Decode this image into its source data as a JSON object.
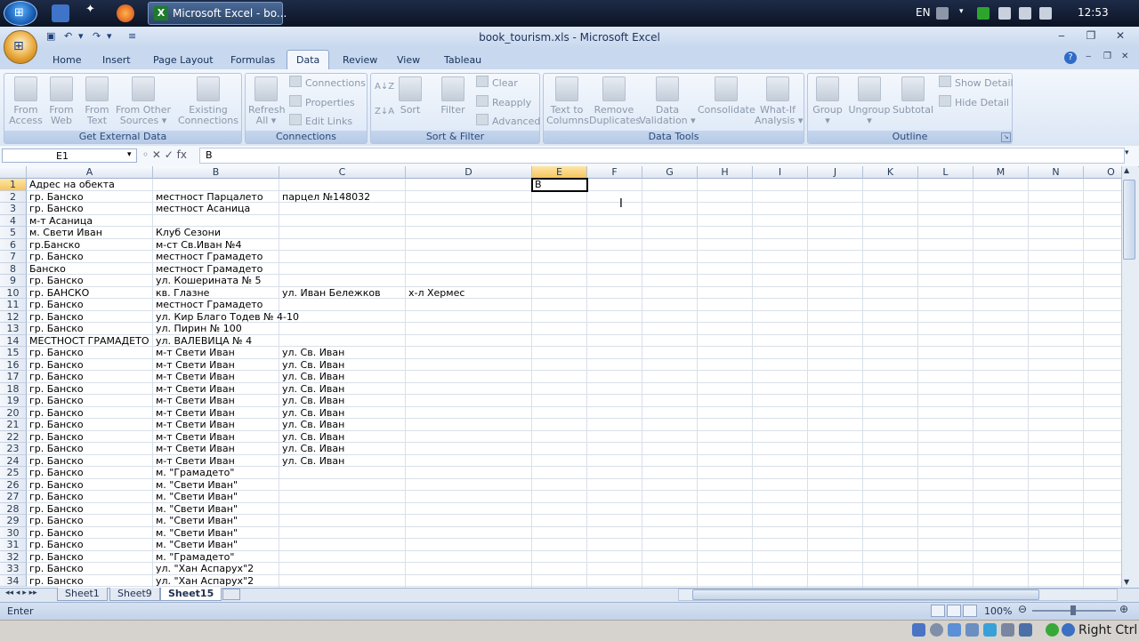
{
  "taskbar": {
    "excel_task_label": "Microsoft Excel - bo...",
    "language": "EN",
    "clock": "12:53",
    "start_glyph": "⊞",
    "excel_glyph": "X"
  },
  "window": {
    "title": "book_tourism.xls - Microsoft Excel",
    "qat": [
      "▣",
      "↶",
      "▾",
      "↷",
      "▾",
      "≡"
    ],
    "controls": [
      "‒",
      "❐",
      "✕"
    ],
    "ribbon_controls": [
      "?",
      "‒",
      "❐",
      "✕"
    ]
  },
  "ribbon_tabs": [
    {
      "label": "Home"
    },
    {
      "label": "Insert"
    },
    {
      "label": "Page Layout"
    },
    {
      "label": "Formulas"
    },
    {
      "label": "Data"
    },
    {
      "label": "Review"
    },
    {
      "label": "View"
    },
    {
      "label": "Tableau"
    }
  ],
  "active_tab": "Data",
  "ribbon": {
    "get_external": {
      "label": "Get External Data",
      "buttons": [
        "From\nAccess",
        "From\nWeb",
        "From\nText",
        "From Other\nSources ▾",
        "Existing\nConnections"
      ]
    },
    "connections": {
      "label": "Connections",
      "refresh": "Refresh\nAll ▾",
      "items": [
        "Connections",
        "Properties",
        "Edit Links"
      ]
    },
    "sort_filter": {
      "label": "Sort & Filter",
      "sort_az": "A↓Z",
      "sort_za": "Z↓A",
      "sort": "Sort",
      "filter": "Filter",
      "items": [
        "Clear",
        "Reapply",
        "Advanced"
      ]
    },
    "data_tools": {
      "label": "Data Tools",
      "buttons": [
        "Text to\nColumns",
        "Remove\nDuplicates",
        "Data\nValidation ▾",
        "Consolidate",
        "What-If\nAnalysis ▾"
      ]
    },
    "outline": {
      "label": "Outline",
      "buttons": [
        "Group\n▾",
        "Ungroup\n▾",
        "Subtotal"
      ],
      "items": [
        "Show Detail",
        "Hide Detail"
      ]
    }
  },
  "formula_bar": {
    "name_box": "E1",
    "buttons": "◦ ✕ ✓ fx",
    "content": "B"
  },
  "columns": [
    "A",
    "B",
    "C",
    "D",
    "E",
    "F",
    "G",
    "H",
    "I",
    "J",
    "K",
    "L",
    "M",
    "N",
    "O"
  ],
  "selected_column": "E",
  "selected_row": "1",
  "active_cell_value": "B",
  "rows": [
    {
      "n": "1",
      "a": "Адрес на обекта",
      "b": "",
      "c": "",
      "d": ""
    },
    {
      "n": "2",
      "a": "гр. Банско",
      "b": "местност Парцалето",
      "c": "парцел №148032",
      "d": ""
    },
    {
      "n": "3",
      "a": "гр. Банско",
      "b": "местност Асаница",
      "c": "",
      "d": ""
    },
    {
      "n": "4",
      "a": "м-т Асаница",
      "b": "",
      "c": "",
      "d": ""
    },
    {
      "n": "5",
      "a": "м. Свети Иван",
      "b": "Клуб Сезони",
      "c": "",
      "d": ""
    },
    {
      "n": "6",
      "a": "гр.Банско",
      "b": "м-ст Св.Иван №4",
      "c": "",
      "d": ""
    },
    {
      "n": "7",
      "a": "гр. Банско",
      "b": "местност Грамадето",
      "c": "",
      "d": ""
    },
    {
      "n": "8",
      "a": "Банско",
      "b": "местност Грамадето",
      "c": "",
      "d": ""
    },
    {
      "n": "9",
      "a": "гр. Банско",
      "b": "ул. Кошерината № 5",
      "c": "",
      "d": ""
    },
    {
      "n": "10",
      "a": "гр. БАНСКО",
      "b": "кв. Глазне",
      "c": "ул. Иван Бележков",
      "d": "х-л Хермес"
    },
    {
      "n": "11",
      "a": "гр. Банско",
      "b": "местност Грамадето",
      "c": "",
      "d": ""
    },
    {
      "n": "12",
      "a": "гр. Банско",
      "b": "ул. Кир Благо Тодев № 4-10",
      "c": "",
      "d": ""
    },
    {
      "n": "13",
      "a": "гр. Банско",
      "b": "ул. Пирин № 100",
      "c": "",
      "d": ""
    },
    {
      "n": "14",
      "a": "МЕСТНОСТ ГРАМАДЕТО",
      "b": "ул. ВАЛЕВИЦА № 4",
      "c": "",
      "d": ""
    },
    {
      "n": "15",
      "a": "гр. Банско",
      "b": "м-т Свети Иван",
      "c": "ул. Св. Иван",
      "d": ""
    },
    {
      "n": "16",
      "a": "гр. Банско",
      "b": "м-т Свети Иван",
      "c": "ул. Св. Иван",
      "d": ""
    },
    {
      "n": "17",
      "a": "гр. Банско",
      "b": "м-т Свети Иван",
      "c": "ул. Св. Иван",
      "d": ""
    },
    {
      "n": "18",
      "a": "гр. Банско",
      "b": "м-т Свети Иван",
      "c": "ул. Св. Иван",
      "d": ""
    },
    {
      "n": "19",
      "a": "гр. Банско",
      "b": "м-т Свети Иван",
      "c": "ул. Св. Иван",
      "d": ""
    },
    {
      "n": "20",
      "a": "гр. Банско",
      "b": "м-т Свети Иван",
      "c": "ул. Св. Иван",
      "d": ""
    },
    {
      "n": "21",
      "a": "гр. Банско",
      "b": "м-т Свети Иван",
      "c": "ул. Св. Иван",
      "d": ""
    },
    {
      "n": "22",
      "a": "гр. Банско",
      "b": "м-т Свети Иван",
      "c": "ул. Св. Иван",
      "d": ""
    },
    {
      "n": "23",
      "a": "гр. Банско",
      "b": "м-т Свети Иван",
      "c": "ул. Св. Иван",
      "d": ""
    },
    {
      "n": "24",
      "a": "гр. Банско",
      "b": "м-т Свети Иван",
      "c": "ул. Св. Иван",
      "d": ""
    },
    {
      "n": "25",
      "a": "гр. Банско",
      "b": "м. \"Грамадето\"",
      "c": "",
      "d": ""
    },
    {
      "n": "26",
      "a": "гр. Банско",
      "b": "м. \"Свети Иван\"",
      "c": "",
      "d": ""
    },
    {
      "n": "27",
      "a": "гр. Банско",
      "b": "м. \"Свети Иван\"",
      "c": "",
      "d": ""
    },
    {
      "n": "28",
      "a": "гр. Банско",
      "b": "м. \"Свети Иван\"",
      "c": "",
      "d": ""
    },
    {
      "n": "29",
      "a": "гр. Банско",
      "b": "м. \"Свети Иван\"",
      "c": "",
      "d": ""
    },
    {
      "n": "30",
      "a": "гр. Банско",
      "b": "м. \"Свети Иван\"",
      "c": "",
      "d": ""
    },
    {
      "n": "31",
      "a": "гр. Банско",
      "b": "м. \"Свети Иван\"",
      "c": "",
      "d": ""
    },
    {
      "n": "32",
      "a": "гр. Банско",
      "b": "м. \"Грамадето\"",
      "c": "",
      "d": ""
    },
    {
      "n": "33",
      "a": "гр. Банско",
      "b": "ул. \"Хан Аспарух\"2",
      "c": "",
      "d": ""
    },
    {
      "n": "34",
      "a": "гр. Банско",
      "b": "ул. \"Хан Аспарух\"2",
      "c": "",
      "d": ""
    }
  ],
  "sheet_nav": "◂◂ ◂ ▸ ▸▸",
  "sheets": [
    {
      "label": "Sheet1",
      "active": false
    },
    {
      "label": "Sheet9",
      "active": false
    },
    {
      "label": "Sheet15",
      "active": true
    }
  ],
  "status": {
    "mode": "Enter",
    "zoom": "100%",
    "zoom_minus": "⊖",
    "zoom_plus": "⊕"
  },
  "system_tray": {
    "host_key_label": "Right Ctrl"
  },
  "colors": {
    "accent": "#1e7b2d",
    "selection_header": "#f7c55d",
    "ribbon_bg": "#dbe6f5"
  }
}
